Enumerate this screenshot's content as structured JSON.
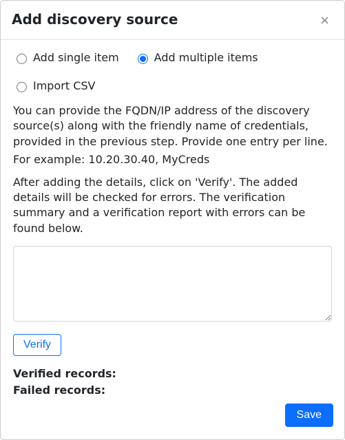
{
  "modal": {
    "title": "Add discovery source",
    "close_glyph": "×"
  },
  "radios": {
    "single_label": "Add single item",
    "multiple_label": "Add multiple items",
    "import_label": "Import CSV",
    "selected": "multiple"
  },
  "help": {
    "p1": "You can provide the FQDN/IP address of the discovery source(s) along with the friendly name of credentials, provided in the previous step. Provide one entry per line.",
    "example": "For example: 10.20.30.40, MyCreds",
    "p2": "After adding the details, click on 'Verify'. The added details will be checked for errors. The verification summary and a verification report with errors can be found below."
  },
  "input": {
    "value": "",
    "placeholder": ""
  },
  "buttons": {
    "verify": "Verify",
    "save": "Save"
  },
  "summary": {
    "verified_label": "Verified records:",
    "verified_value": "",
    "failed_label": "Failed records:",
    "failed_value": ""
  }
}
